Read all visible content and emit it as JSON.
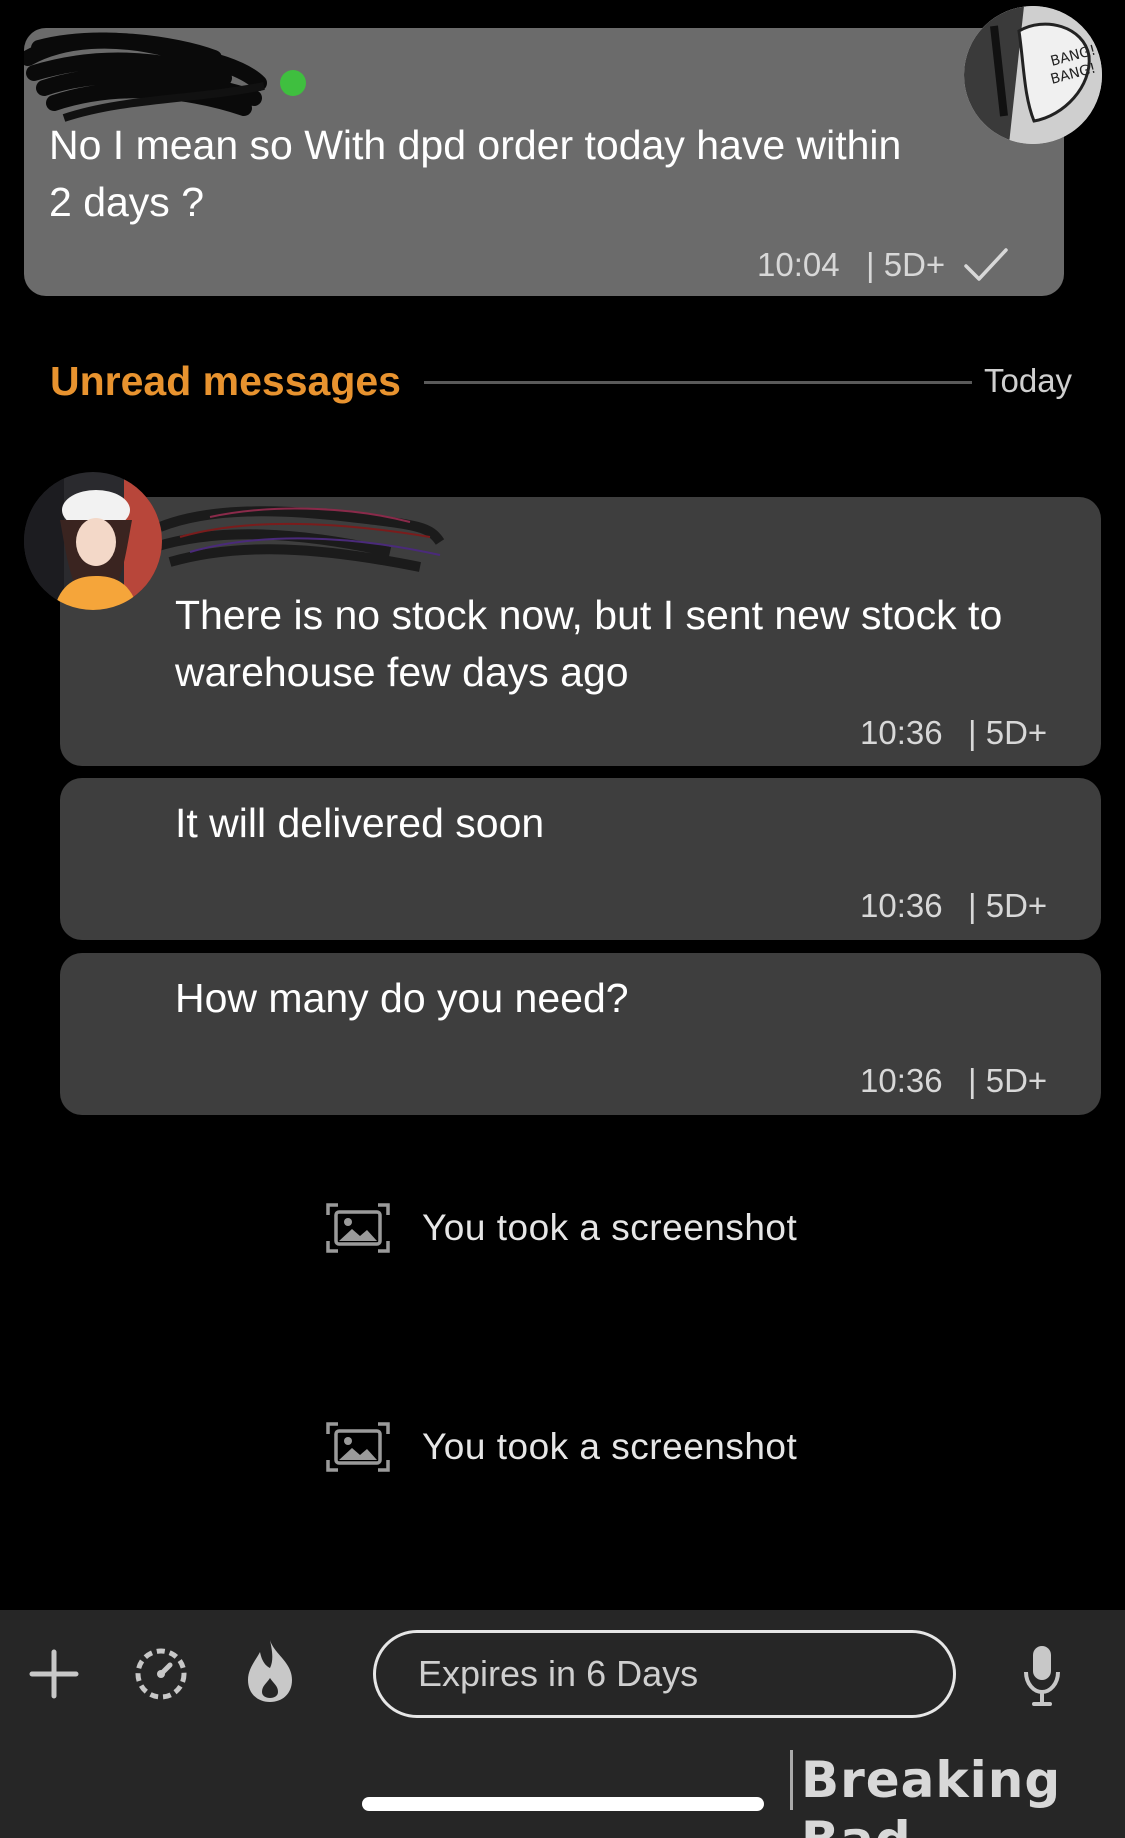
{
  "outgoing_message": {
    "text": "No I mean so With dpd order today have within 2 days ?",
    "time": "10:04",
    "expiry": "| 5D+",
    "status": "read-check"
  },
  "unread_divider": {
    "label": "Unread messages",
    "date": "Today"
  },
  "incoming_messages": [
    {
      "text": "There is no stock now, but I sent new stock to warehouse few days ago",
      "time": "10:36",
      "expiry": "| 5D+"
    },
    {
      "text": "It will delivered soon",
      "time": "10:36",
      "expiry": "| 5D+"
    },
    {
      "text": "How many do you need?",
      "time": "10:36",
      "expiry": "| 5D+"
    }
  ],
  "system_notes": [
    {
      "text": "You took a screenshot",
      "icon": "screenshot-icon"
    },
    {
      "text": "You took a screenshot",
      "icon": "screenshot-icon"
    }
  ],
  "composer": {
    "placeholder": "Expires in 6 Days",
    "icons": [
      "plus-icon",
      "timer-icon",
      "flame-icon",
      "microphone-icon"
    ]
  },
  "watermark": "Breaking Bad",
  "colors": {
    "background": "#000000",
    "outgoing_bubble": "#6b6b6b",
    "incoming_bubble": "#3e3e3e",
    "unread_accent": "#e8932f",
    "online_dot": "#3fbf3f",
    "bottom_bar": "#262626"
  }
}
